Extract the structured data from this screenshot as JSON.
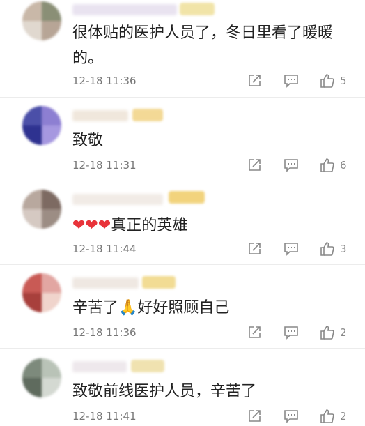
{
  "comments": [
    {
      "text": "很体贴的医护人员了，冬日里看了暖暖的。",
      "time": "12-18 11:36",
      "likes": "5",
      "avatar_colors": [
        "#c9b8a8",
        "#8a8f76",
        "#e0d8cf",
        "#b7a596",
        "#6f7460",
        "#d8cdbf"
      ],
      "name_color": "#e9e3f0",
      "badge_color": "#f1e4a8"
    },
    {
      "text": "致敬",
      "time": "12-18 11:31",
      "likes": "6",
      "avatar_colors": [
        "#4b4fa8",
        "#8d7fd2",
        "#2e3290",
        "#a698e0",
        "#5a5fbf",
        "#3b3d96"
      ],
      "name_color": "#f0e7dc",
      "badge_color": "#f3d996"
    },
    {
      "emoji": "❤❤❤",
      "text": "真正的英雄",
      "time": "12-18 11:44",
      "likes": "3",
      "avatar_colors": [
        "#b8a89e",
        "#7d6a62",
        "#d5c9c2",
        "#9c8d84",
        "#c7b8b0",
        "#f2d36a"
      ],
      "name_color": "#f1ebe6",
      "badge_color": "#f2d37d"
    },
    {
      "text": "辛苦了🙏好好照顾自己",
      "time": "12-18 11:36",
      "likes": "2",
      "avatar_colors": [
        "#c95a55",
        "#e2a6a2",
        "#a8403c",
        "#f0d4cc",
        "#d9847e",
        "#b74c47"
      ],
      "name_color": "#efe8e2",
      "badge_color": "#f2dc94"
    },
    {
      "text": "致敬前线医护人员，辛苦了",
      "time": "12-18 11:41",
      "likes": "2",
      "avatar_colors": [
        "#7d8a7c",
        "#b9c3b7",
        "#5f6b5e",
        "#d4d9d2",
        "#95a193",
        "#6e7a6c"
      ],
      "name_color": "#eee8ec",
      "badge_color": "#f0e2b0"
    }
  ],
  "icons": {
    "share": "share-icon",
    "reply": "comment-icon",
    "like": "thumbs-up-icon"
  }
}
